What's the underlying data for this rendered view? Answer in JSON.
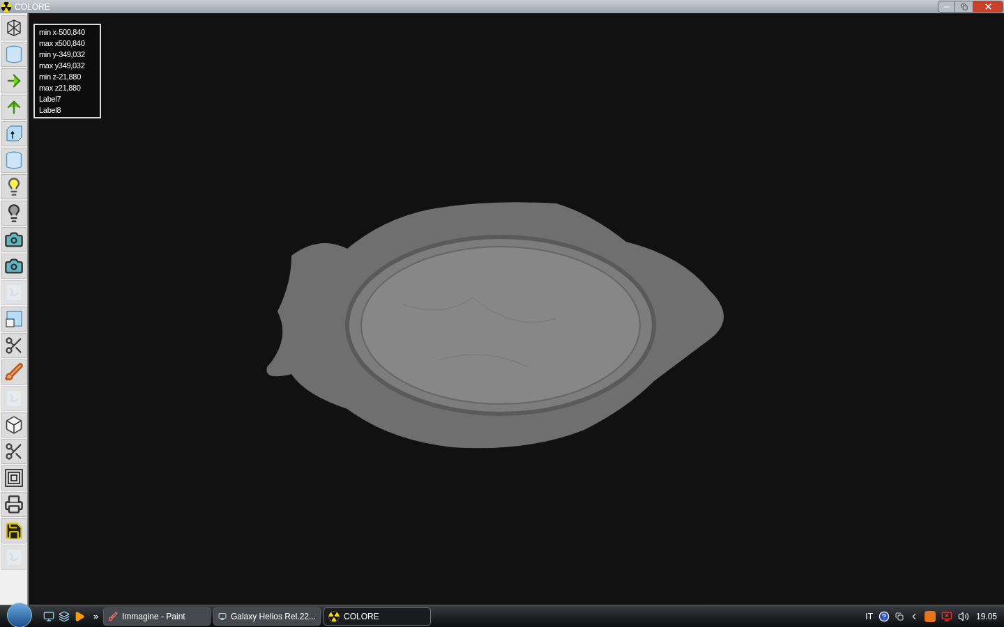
{
  "window": {
    "title": "COLORE"
  },
  "toolbar": [
    {
      "kind": "wireframe",
      "disabled": false
    },
    {
      "kind": "cylinder",
      "disabled": false
    },
    {
      "kind": "arrow-right",
      "disabled": false
    },
    {
      "kind": "arrow-up",
      "disabled": false
    },
    {
      "kind": "cube-arrow",
      "disabled": false
    },
    {
      "kind": "cylinder",
      "disabled": false
    },
    {
      "kind": "bulb-on",
      "disabled": false
    },
    {
      "kind": "bulb-off",
      "disabled": false
    },
    {
      "kind": "camera",
      "disabled": false
    },
    {
      "kind": "camera",
      "disabled": false
    },
    {
      "kind": "texture",
      "disabled": true
    },
    {
      "kind": "window",
      "disabled": false
    },
    {
      "kind": "scissors",
      "disabled": false
    },
    {
      "kind": "brush",
      "disabled": false
    },
    {
      "kind": "texture",
      "disabled": true
    },
    {
      "kind": "cube",
      "disabled": false
    },
    {
      "kind": "scissors",
      "disabled": false
    },
    {
      "kind": "squares",
      "disabled": false
    },
    {
      "kind": "printer",
      "disabled": false
    },
    {
      "kind": "floppy",
      "disabled": false
    },
    {
      "kind": "texture",
      "disabled": true
    }
  ],
  "info_labels": [
    "min x-500,840",
    "max x500,840",
    "min y-349,032",
    "max y349,032",
    "min z-21,880",
    "max z21,880",
    "Label7",
    "Label8"
  ],
  "taskbar": {
    "more": "»",
    "tasks": [
      {
        "label": "Immagine - Paint",
        "kind": "paint",
        "selected": false
      },
      {
        "label": "Galaxy Helios  Rel.22...",
        "kind": "app",
        "selected": false
      },
      {
        "label": "COLORE",
        "kind": "radiation",
        "selected": true
      }
    ],
    "language": "IT",
    "clock": "19.05"
  }
}
